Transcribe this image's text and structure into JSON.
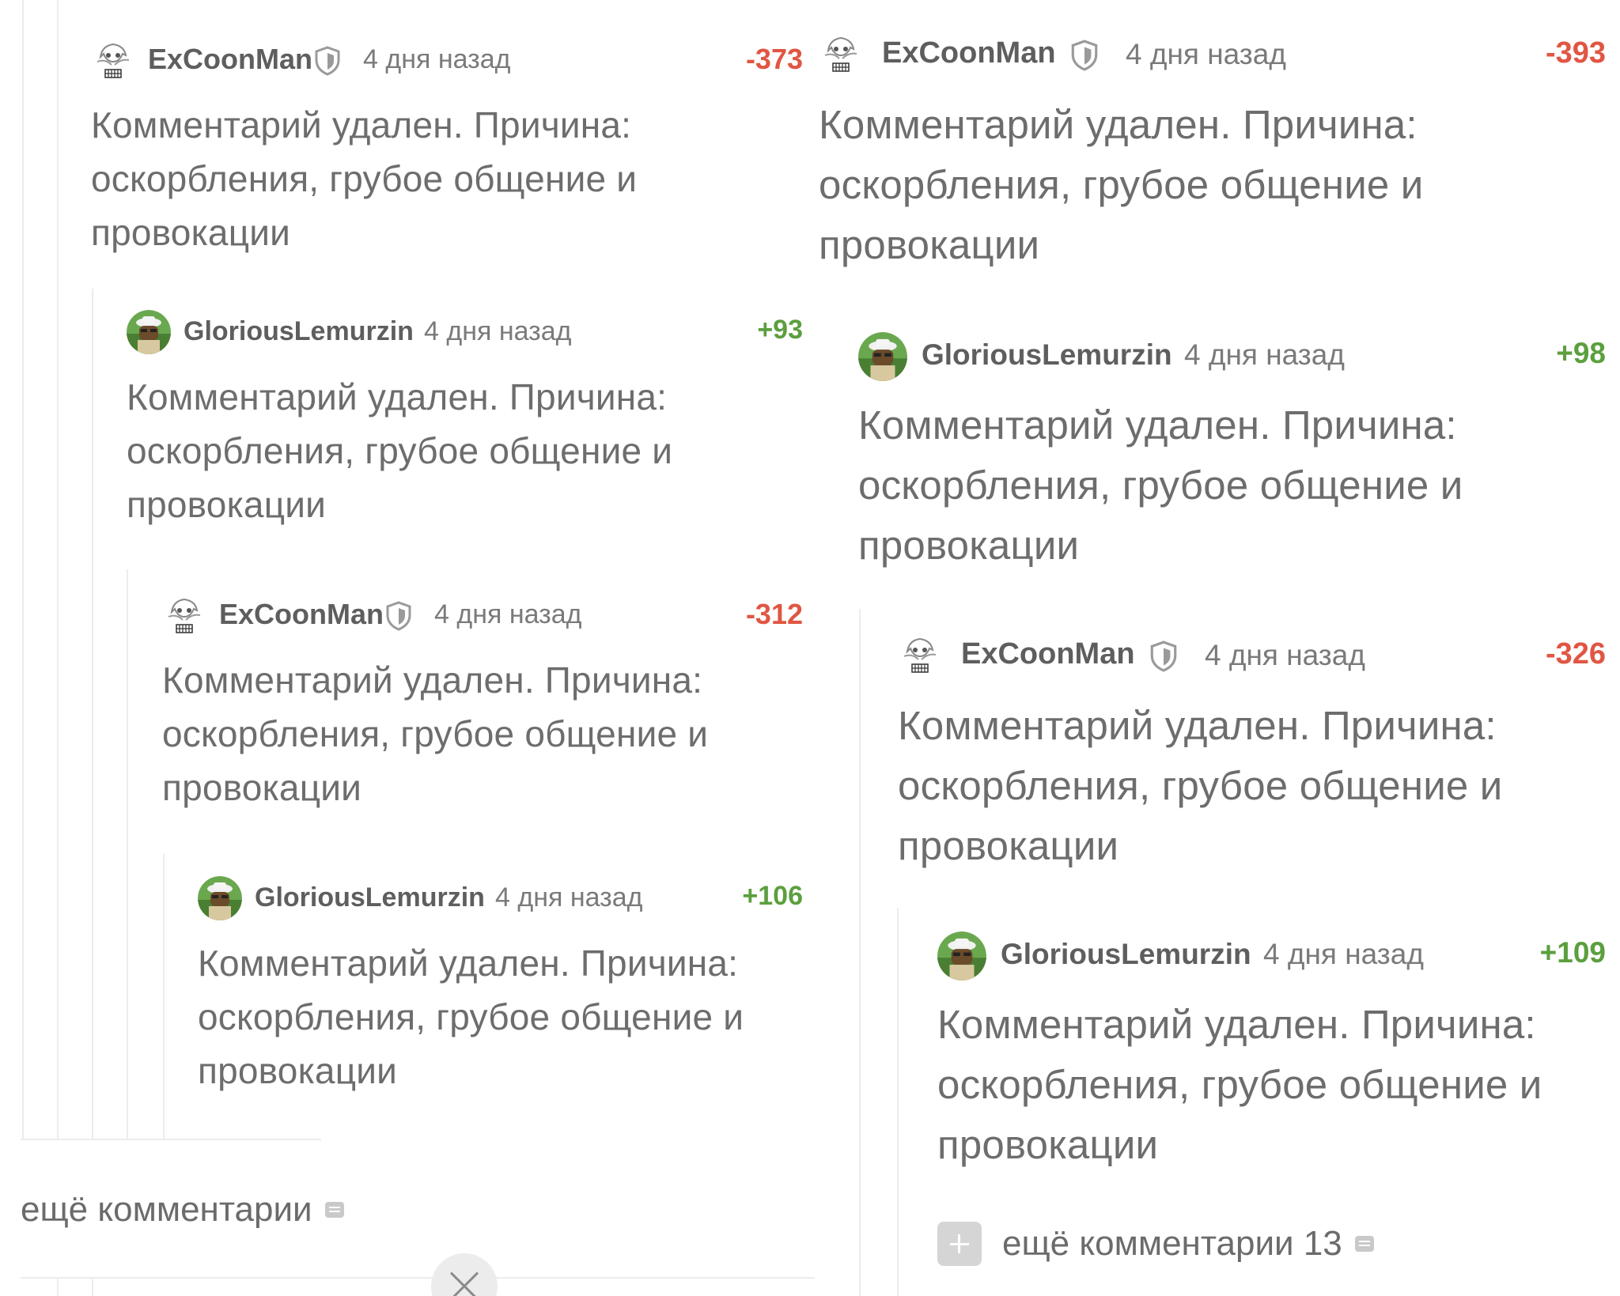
{
  "left": {
    "comments": [
      {
        "author": "ExCoonMan",
        "time": "4 дня назад",
        "rating": "-373",
        "body": "Комментарий удален. Причина: оскорбления, грубое общение и провокации"
      },
      {
        "author": "GloriousLemurzin",
        "time": "4 дня назад",
        "rating": "+93",
        "body": "Комментарий удален. Причина: оскорбления, грубое общение и провокации"
      },
      {
        "author": "ExCoonMan",
        "time": "4 дня назад",
        "rating": "-312",
        "body": "Комментарий удален. Причина: оскорбления, грубое общение и провокации"
      },
      {
        "author": "GloriousLemurzin",
        "time": "4 дня назад",
        "rating": "+106",
        "body": "Комментарий удален. Причина: оскорбления, грубое общение и провокации"
      }
    ],
    "more_label": "ещё комментарии"
  },
  "right": {
    "comments": [
      {
        "author": "ExCoonMan",
        "time": "4 дня назад",
        "rating": "-393",
        "body": "Комментарий удален. Причина: оскорбления, грубое общение и провокации"
      },
      {
        "author": "GloriousLemurzin",
        "time": "4 дня назад",
        "rating": "+98",
        "body": "Комментарий удален. Причина: оскорбления, грубое общение и провокации"
      },
      {
        "author": "ExCoonMan",
        "time": "4 дня назад",
        "rating": "-326",
        "body": "Комментарий удален. Причина: оскорбления, грубое общение и провокации"
      },
      {
        "author": "GloriousLemurzin",
        "time": "4 дня назад",
        "rating": "+109",
        "body": "Комментарий удален. Причина: оскорбления, грубое общение и провокации"
      }
    ],
    "more_label": "ещё комментарии 13"
  },
  "colors": {
    "negative": "#e05643",
    "positive": "#5c9f3e",
    "text": "#6d6d6d"
  }
}
